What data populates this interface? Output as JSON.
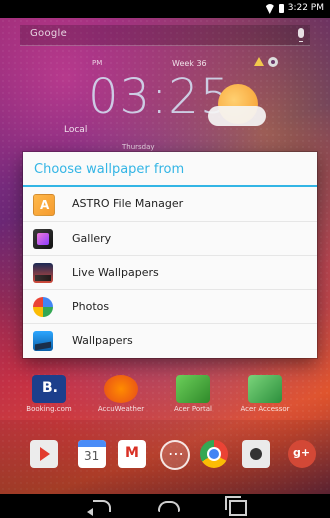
{
  "status_bar": {
    "time": "3:22 PM"
  },
  "search_bar": {
    "label": "Google"
  },
  "clock_widget": {
    "period": "PM",
    "week": "Week 36",
    "time": "03:25",
    "location": "Local",
    "day": "Thursday"
  },
  "dialog": {
    "title": "Choose wallpaper from",
    "items": [
      {
        "label": "ASTRO File Manager",
        "icon": "astro-icon"
      },
      {
        "label": "Gallery",
        "icon": "gallery-icon"
      },
      {
        "label": "Live Wallpapers",
        "icon": "live-wallpapers-icon"
      },
      {
        "label": "Photos",
        "icon": "photos-icon"
      },
      {
        "label": "Wallpapers",
        "icon": "wallpapers-icon"
      }
    ]
  },
  "home_apps": [
    {
      "label": "Booking.com",
      "icon": "booking-icon"
    },
    {
      "label": "AccuWeather",
      "icon": "accuweather-icon"
    },
    {
      "label": "Acer Portal",
      "icon": "acer-portal-icon"
    },
    {
      "label": "Acer Accessor",
      "icon": "acer-accessory-icon"
    }
  ],
  "dock": {
    "icons": [
      "play-store-icon",
      "calendar-icon",
      "gmail-icon",
      "apps-icon",
      "chrome-icon",
      "camera-icon",
      "google-plus-icon"
    ]
  },
  "navigation": {
    "back": "back-icon",
    "home": "home-icon",
    "recent": "recent-apps-icon"
  },
  "colors": {
    "accent": "#33b5e5"
  }
}
